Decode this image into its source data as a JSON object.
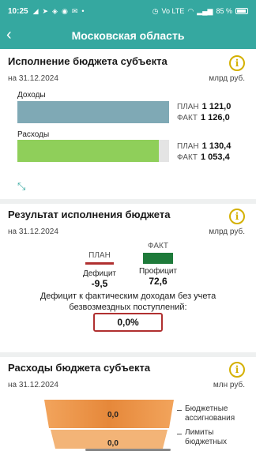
{
  "status": {
    "time": "10:25",
    "left_icons": [
      "telegram-icon",
      "send-icon",
      "vpn-icon",
      "whatsapp-icon",
      "mail-icon",
      "dot-icon"
    ],
    "right_text": "85 %",
    "network": "Vo LTE"
  },
  "header": {
    "title": "Московская область"
  },
  "budget": {
    "title": "Исполнение бюджета субъекта",
    "date": "на 31.12.2024",
    "unit": "млрд  руб.",
    "income_label": "Доходы",
    "expense_label": "Расходы",
    "income_plan_label": "ПЛАН",
    "income_plan_value": "1 121,0",
    "income_fact_label": "ФАКТ",
    "income_fact_value": "1 126,0",
    "expense_plan_label": "ПЛАН",
    "expense_plan_value": "1 130,4",
    "expense_fact_label": "ФАКТ",
    "expense_fact_value": "1 053,4",
    "income_fill_fraction": 1.0,
    "expense_fill_fraction": 0.932,
    "income_color": "#7fa9b5",
    "expense_color": "#8fcf5a"
  },
  "result": {
    "title": "Результат исполнения бюджета",
    "date": "на 31.12.2024",
    "unit": "млрд  руб.",
    "plan_label": "ПЛАН",
    "fact_label": "ФАКТ",
    "deficit_label": "Дефицит",
    "deficit_value": "-9,5",
    "surplus_label": "Профицит",
    "surplus_value": "72,6",
    "deficit_note_line1": "Дефицит к фактическим доходам без учета",
    "deficit_note_line2": "безвозмездных поступлений:",
    "deficit_pct": "0,0%"
  },
  "expenses": {
    "title": "Расходы бюджета субъекта",
    "date": "на 31.12.2024",
    "unit": "млн  руб.",
    "row1_value": "0,0",
    "row1_caption_a": "Бюджетные",
    "row1_caption_b": "ассигнования",
    "row2_value": "0,0",
    "row2_caption_a": "Лимиты",
    "row2_caption_b": "бюджетных"
  }
}
